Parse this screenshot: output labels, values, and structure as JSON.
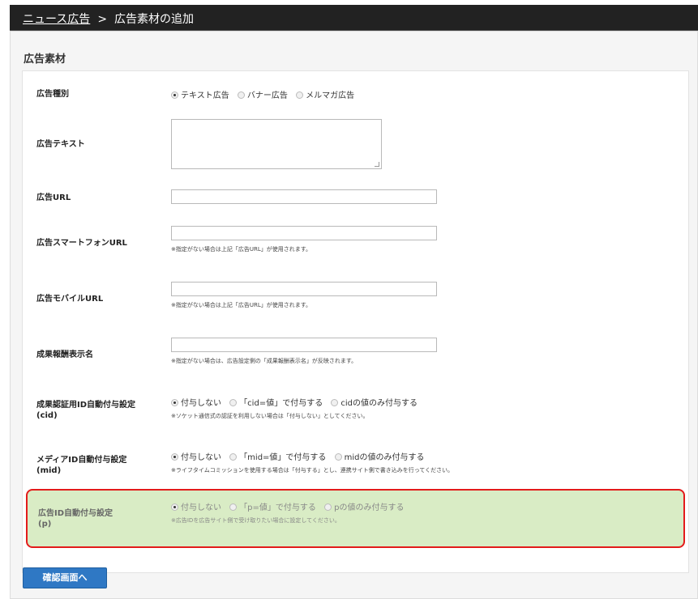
{
  "breadcrumb": {
    "parent": "ニュース広告",
    "separator": ">",
    "current": "広告素材の追加"
  },
  "section_title": "広告素材",
  "fields": {
    "ad_type": {
      "label": "広告種別",
      "options": [
        "テキスト広告",
        "バナー広告",
        "メルマガ広告"
      ],
      "selected": "テキスト広告"
    },
    "ad_text": {
      "label": "広告テキスト",
      "value": ""
    },
    "ad_url": {
      "label": "広告URL",
      "value": ""
    },
    "ad_sp_url": {
      "label": "広告スマートフォンURL",
      "value": "",
      "note": "※指定がない場合は上記「広告URL」が使用されます。"
    },
    "ad_mobile_url": {
      "label": "広告モバイルURL",
      "value": "",
      "note": "※指定がない場合は上記「広告URL」が使用されます。"
    },
    "reward_name": {
      "label": "成果報酬表示名",
      "value": "",
      "note": "※指定がない場合は、広告設定側の「成果報酬表示名」が反映されます。"
    },
    "cid_setting": {
      "label": "成果認証用ID自動付与設定",
      "label_sub": "(cid)",
      "options": [
        "付与しない",
        "「cid=値」で付与する",
        "cidの値のみ付与する"
      ],
      "selected": "付与しない",
      "note": "※ソケット通信式の認証を利用しない場合は「付与しない」としてください。"
    },
    "mid_setting": {
      "label": "メディアID自動付与設定",
      "label_sub": "(mid)",
      "options": [
        "付与しない",
        "「mid=値」で付与する",
        "midの値のみ付与する"
      ],
      "selected": "付与しない",
      "note": "※ライフタイムコミッションを使用する場合は「付与する」とし、連携サイト側で書き込みを行ってください。"
    },
    "p_setting": {
      "label": "広告ID自動付与設定",
      "label_sub": "(p)",
      "options": [
        "付与しない",
        "「p=値」で付与する",
        "pの値のみ付与する"
      ],
      "selected": "付与しない",
      "note": "※広告IDを広告サイト側で受け取りたい場合に設定してください。"
    }
  },
  "confirm_button": "確認画面へ",
  "colors": {
    "header_bg": "#222222",
    "highlight_bg": "#d9ecc5",
    "highlight_border": "#e31b1b",
    "button_bg": "#2f78c4"
  }
}
